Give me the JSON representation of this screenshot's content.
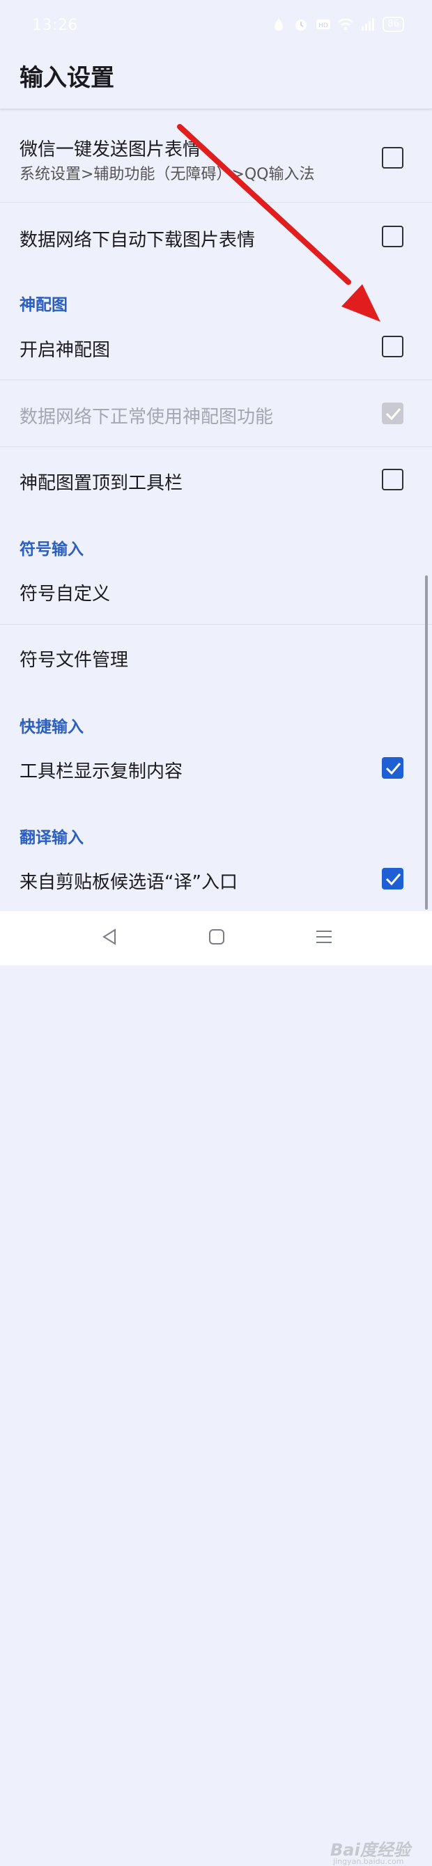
{
  "status": {
    "time": "13:26",
    "battery": "86"
  },
  "header": {
    "title": "输入设置"
  },
  "rows": [
    {
      "title": "微信一键发送图片表情",
      "subtitle": "系统设置>辅助功能（无障碍）>QQ输入法",
      "checked": false
    },
    {
      "title": "数据网络下自动下载图片表情",
      "checked": false
    },
    {
      "title": "开启神配图",
      "checked": false
    },
    {
      "title": "数据网络下正常使用神配图功能",
      "checked": true,
      "disabled": true
    },
    {
      "title": "神配图置顶到工具栏",
      "checked": false
    },
    {
      "title": "符号自定义"
    },
    {
      "title": "符号文件管理"
    },
    {
      "title": "工具栏显示复制内容",
      "checked": true
    },
    {
      "title": "来自剪贴板候选语“译”入口",
      "checked": true
    }
  ],
  "sections": {
    "shenpeitu": "神配图",
    "symbol_input": "符号输入",
    "quick_input": "快捷输入",
    "translate_input": "翻译输入"
  },
  "watermark": {
    "brand": "Bai度经验",
    "url": "jingyan.baidu.com"
  },
  "colors": {
    "accent": "#1e5fd6",
    "section": "#2a5fc1",
    "annotation_arrow": "#e11d1d",
    "background": "#eef0fb"
  },
  "icons": [
    "water-drop-icon",
    "alarm-icon",
    "hd-icon",
    "wifi-icon",
    "signal-icon",
    "battery-icon",
    "back-icon",
    "home-icon",
    "menu-icon"
  ]
}
